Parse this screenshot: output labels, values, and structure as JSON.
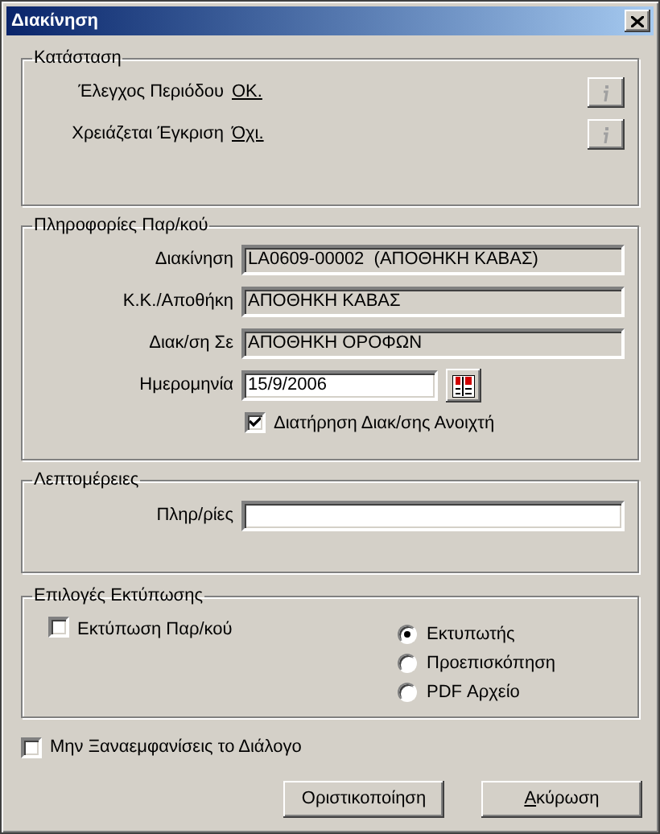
{
  "window": {
    "title": "Διακίνηση"
  },
  "status": {
    "title": "Κατάσταση",
    "rows": [
      {
        "label": "Έλεγχος Περιόδου",
        "value": "OK."
      },
      {
        "label": "Χρειάζεται Έγκριση",
        "value": "Όχι."
      }
    ]
  },
  "document_info": {
    "title": "Πληροφορίες Παρ/κού",
    "fields": [
      {
        "kind": "text",
        "label": "Διακίνηση",
        "value": "LA0609-00002  (ΑΠΟΘΗΚΗ ΚΑΒΑΣ)",
        "disabled": true
      },
      {
        "kind": "text",
        "label": "Κ.Κ./Αποθήκη",
        "value": "ΑΠΟΘΗΚΗ ΚΑΒΑΣ",
        "disabled": true
      },
      {
        "kind": "text",
        "label": "Διακ/ση Σε",
        "value": "ΑΠΟΘΗΚΗ ΟΡΟΦΩΝ",
        "disabled": true
      },
      {
        "kind": "date",
        "label": "Ημερομηνία",
        "value": "15/9/2006",
        "disabled": false
      }
    ],
    "keep_open": {
      "label": "Διατήρηση Διακ/σης Ανοιχτή",
      "checked": true
    }
  },
  "details": {
    "title": "Λεπτομέρειες",
    "fields": [
      {
        "label": "Πληρ/ρίες"
      }
    ]
  },
  "print_options": {
    "title": "Επιλογές Εκτύπωσης",
    "print_document": {
      "label": "Εκτύπωση Παρ/κού",
      "checked": false
    },
    "destinations": [
      {
        "label": "Εκτυπωτής",
        "selected": true
      },
      {
        "label": "Προεπισκόπηση",
        "selected": false
      },
      {
        "label": "PDF Αρχείο",
        "selected": false
      }
    ]
  },
  "dont_show_again": {
    "label": "Μην Ξαναεμφανίσεις το Διάλογο",
    "checked": false
  },
  "buttons": [
    {
      "label": "Οριστικοποίηση",
      "mnemonic_underlined": false
    },
    {
      "label": "Ακύρωση",
      "mnemonic_underlined": true
    }
  ]
}
